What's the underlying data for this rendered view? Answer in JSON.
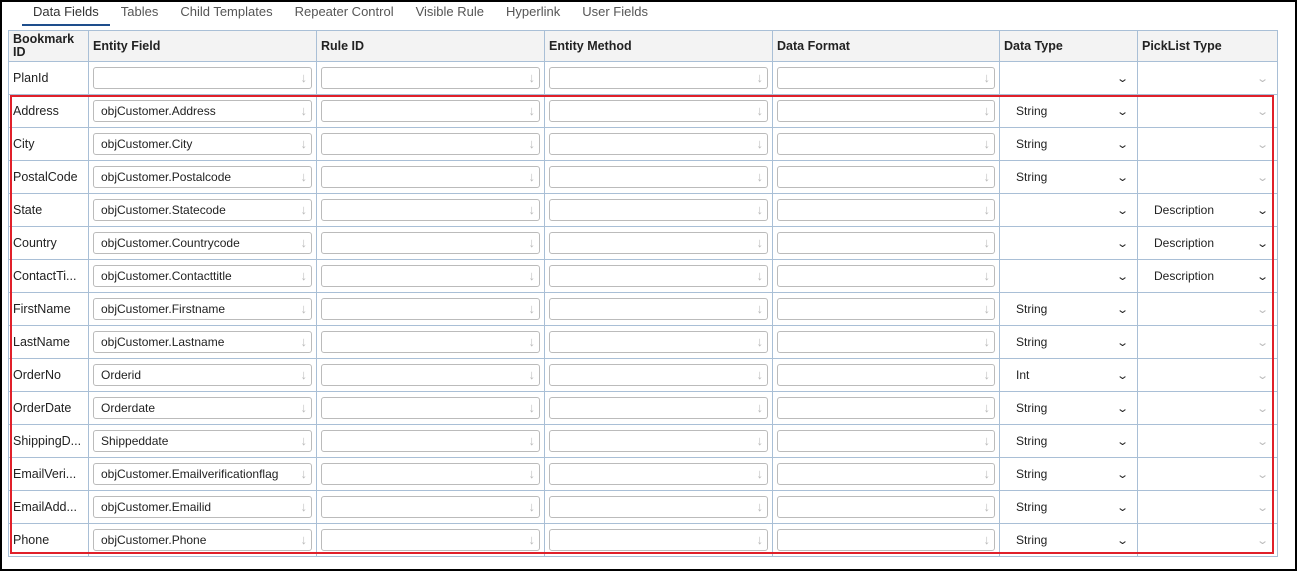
{
  "tabs": [
    "Data Fields",
    "Tables",
    "Child Templates",
    "Repeater Control",
    "Visible Rule",
    "Hyperlink",
    "User Fields"
  ],
  "headers": [
    "Bookmark ID",
    "Entity Field",
    "Rule ID",
    "Entity Method",
    "Data Format",
    "Data Type",
    "PickList Type"
  ],
  "rows": [
    {
      "bookmark": "PlanId",
      "entity": "",
      "datatype": "",
      "picklist": ""
    },
    {
      "bookmark": "Address",
      "entity": "objCustomer.Address",
      "datatype": "String",
      "picklist": ""
    },
    {
      "bookmark": "City",
      "entity": "objCustomer.City",
      "datatype": "String",
      "picklist": ""
    },
    {
      "bookmark": "PostalCode",
      "entity": "objCustomer.Postalcode",
      "datatype": "String",
      "picklist": ""
    },
    {
      "bookmark": "State",
      "entity": "objCustomer.Statecode",
      "datatype": "",
      "picklist": "Description"
    },
    {
      "bookmark": "Country",
      "entity": "objCustomer.Countrycode",
      "datatype": "",
      "picklist": "Description"
    },
    {
      "bookmark": "ContactTi...",
      "entity": "objCustomer.Contacttitle",
      "datatype": "",
      "picklist": "Description"
    },
    {
      "bookmark": "FirstName",
      "entity": "objCustomer.Firstname",
      "datatype": "String",
      "picklist": ""
    },
    {
      "bookmark": "LastName",
      "entity": "objCustomer.Lastname",
      "datatype": "String",
      "picklist": ""
    },
    {
      "bookmark": "OrderNo",
      "entity": "Orderid",
      "datatype": "Int",
      "picklist": ""
    },
    {
      "bookmark": "OrderDate",
      "entity": "Orderdate",
      "datatype": "String",
      "picklist": ""
    },
    {
      "bookmark": "ShippingD...",
      "entity": "Shippeddate",
      "datatype": "String",
      "picklist": ""
    },
    {
      "bookmark": "EmailVeri...",
      "entity": "objCustomer.Emailverificationflag",
      "datatype": "String",
      "picklist": ""
    },
    {
      "bookmark": "EmailAdd...",
      "entity": "objCustomer.Emailid",
      "datatype": "String",
      "picklist": ""
    },
    {
      "bookmark": "Phone",
      "entity": "objCustomer.Phone",
      "datatype": "String",
      "picklist": ""
    }
  ]
}
